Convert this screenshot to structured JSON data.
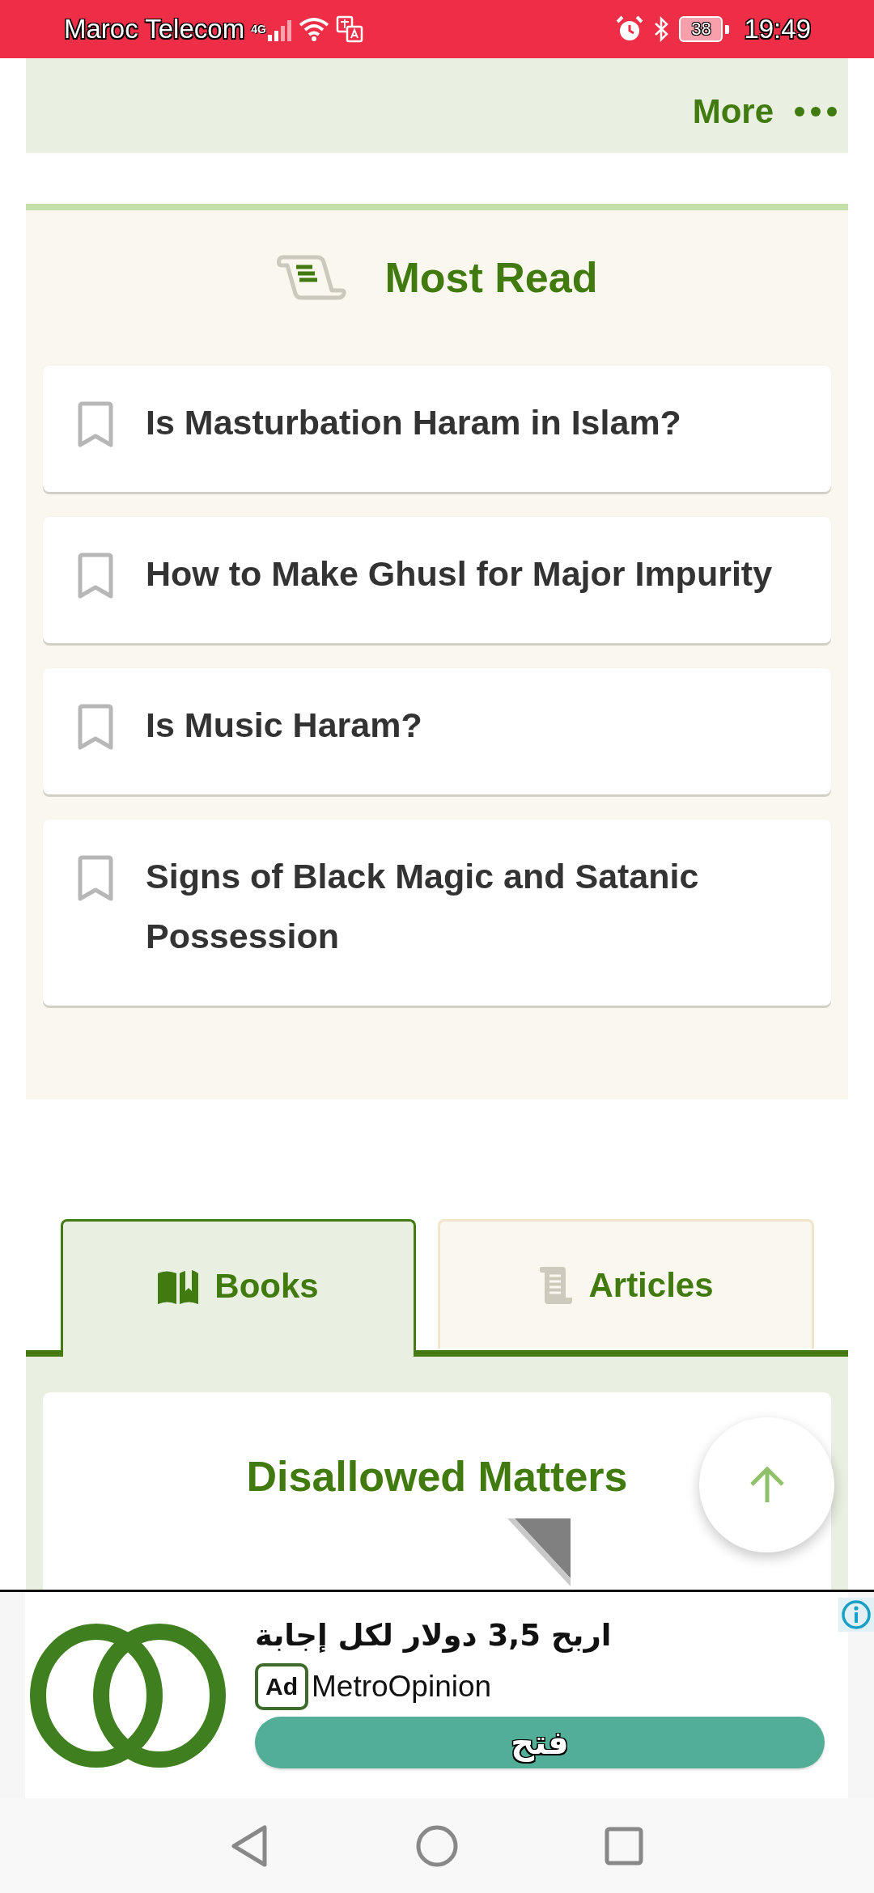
{
  "status_bar": {
    "carrier": "Maroc Telecom",
    "network": "4G",
    "battery": "38",
    "time": "19:49"
  },
  "top_bar": {
    "more": "More"
  },
  "most_read": {
    "title": "Most Read",
    "items": [
      {
        "title": "Is Masturbation Haram in Islam?"
      },
      {
        "title": "How to Make Ghusl for Major Impurity"
      },
      {
        "title": "Is Music Haram?"
      },
      {
        "title": "Signs of Black Magic and Satanic Possession"
      }
    ]
  },
  "tabs": [
    {
      "label": "Books",
      "kind": "books",
      "selected": true
    },
    {
      "label": "Articles",
      "kind": "articles",
      "selected": false
    }
  ],
  "book_card": {
    "title": "Disallowed Matters"
  },
  "ad": {
    "headline": "اربح 3,5 دولار لكل إجابة",
    "badge": "Ad",
    "advertiser": "MetroOpinion",
    "button": "فتح"
  }
}
